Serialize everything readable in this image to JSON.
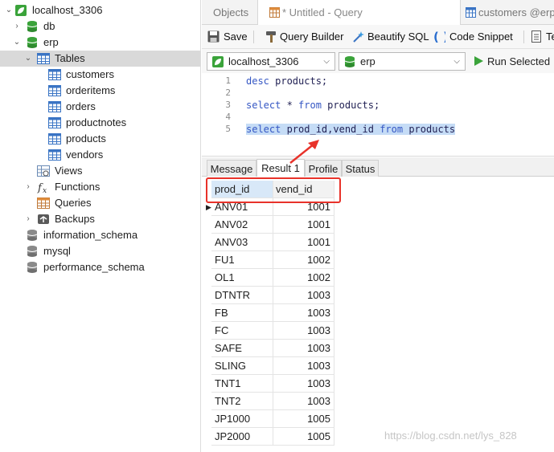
{
  "sidebar": {
    "connection": "localhost_3306",
    "db_db": "db",
    "db_erp": "erp",
    "tables_label": "Tables",
    "tables": [
      "customers",
      "orderitems",
      "orders",
      "productnotes",
      "products",
      "vendors"
    ],
    "views_label": "Views",
    "functions_label": "Functions",
    "queries_label": "Queries",
    "backups_label": "Backups",
    "other_dbs": [
      "information_schema",
      "mysql",
      "performance_schema"
    ]
  },
  "tabs": {
    "objects": "Objects",
    "query": "* Untitled - Query",
    "customers": "customers @erp"
  },
  "toolbar": {
    "save": "Save",
    "query_builder": "Query Builder",
    "beautify": "Beautify SQL",
    "snippet": "Code Snippet",
    "text": "Te"
  },
  "connbar": {
    "connection": "localhost_3306",
    "database": "erp",
    "run": "Run Selected"
  },
  "editor": {
    "line_numbers": [
      "1",
      "2",
      "3",
      "4",
      "5"
    ],
    "line1_kw": "desc",
    "line1_rest": " products;",
    "line3_kw1": "select",
    "line3_mid": " * ",
    "line3_kw2": "from",
    "line3_rest": " products;",
    "line5_kw1": "select",
    "line5_mid": " prod_id,vend_id ",
    "line5_kw2": "from",
    "line5_rest": " products"
  },
  "result_tabs": [
    "Message",
    "Result 1",
    "Profile",
    "Status"
  ],
  "grid": {
    "columns": [
      "prod_id",
      "vend_id"
    ],
    "rows": [
      [
        "ANV01",
        "1001"
      ],
      [
        "ANV02",
        "1001"
      ],
      [
        "ANV03",
        "1001"
      ],
      [
        "FU1",
        "1002"
      ],
      [
        "OL1",
        "1002"
      ],
      [
        "DTNTR",
        "1003"
      ],
      [
        "FB",
        "1003"
      ],
      [
        "FC",
        "1003"
      ],
      [
        "SAFE",
        "1003"
      ],
      [
        "SLING",
        "1003"
      ],
      [
        "TNT1",
        "1003"
      ],
      [
        "TNT2",
        "1003"
      ],
      [
        "JP1000",
        "1005"
      ],
      [
        "JP2000",
        "1005"
      ]
    ]
  },
  "watermark": "https://blog.csdn.net/lys_828",
  "colors": {
    "keyword": "#3557c4",
    "selection": "#c5dcf6",
    "db_icon": "#3aa33a",
    "table_icon": "#3a74c4",
    "annotation_red": "#e8322a",
    "run_green": "#3aa33a"
  },
  "icons": {
    "connection": "leaf-connection-icon",
    "database": "database-icon",
    "table": "table-icon",
    "view": "view-icon",
    "function": "function-icon",
    "query": "query-icon",
    "backup": "backup-icon"
  }
}
